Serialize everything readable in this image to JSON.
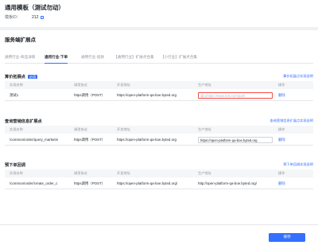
{
  "page": {
    "title": "通用模板（测试勿动）",
    "template_id_label": "模板ID：",
    "template_id_value": "212"
  },
  "section": {
    "title": "服务端扩展点",
    "tabs": [
      {
        "label": "通用行业-商品详情"
      },
      {
        "label": "通用行业-下单"
      },
      {
        "label": "通用行业-退款"
      },
      {
        "label": "【通用行业】扩展点合集"
      },
      {
        "label": "【小行业】扩展点合集"
      }
    ]
  },
  "columns": [
    "实现名称",
    "调用协议",
    "开发地址",
    "生产地址",
    "操作"
  ],
  "groups": [
    {
      "title": "算价拓展点",
      "badge": "必须",
      "link": "算价拓展点实现说明",
      "row": {
        "name": "测试1",
        "protocol": "https调用（POST）",
        "dev_url": "https://open-platform-qa-boe.byted.org",
        "prod_url": "请以https://www.test.com/path",
        "action": "删除"
      }
    },
    {
      "title": "查询营销信息扩展点",
      "link": "查询营销信息扩展点实现说明",
      "row": {
        "name": "/common/order/query_marketin",
        "protocol": "https调用（POST）",
        "dev_url": "https://open-platform-qa-boe.byted.org",
        "prod_url": "https://open-platform-qa-boe.byted.org",
        "action": "删除"
      }
    },
    {
      "title": "预下单回调",
      "link": "预下单回调实现说明",
      "row": {
        "name": "/common/order/create_order_c",
        "protocol": "https调用（POST）",
        "dev_url": "https://open-platform-qa-boe.byted.org/",
        "prod_url": "http://open-platform-qa-boe.byted.org/",
        "action": "删除"
      }
    }
  ],
  "footer": {
    "save_label": "保存"
  },
  "colors": {
    "accent": "#3370ff",
    "error_border": "#f54a45",
    "page_bg": "#eef0f3"
  },
  "icons": {
    "copy": "copy-icon"
  }
}
